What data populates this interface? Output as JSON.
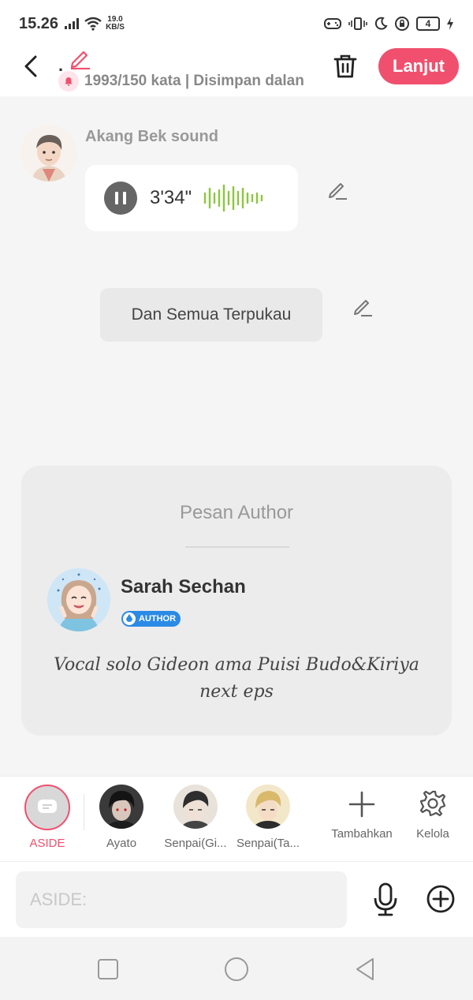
{
  "status": {
    "time": "15.26",
    "speed_top": "19.0",
    "speed_bottom": "KB/S",
    "battery": "4"
  },
  "header": {
    "title_marker": ".",
    "word_count": "1993/150 kata | Disimpan dalan",
    "next_label": "Lanjut"
  },
  "story": {
    "speaker_name": "Akang Bek sound",
    "audio_duration": "3'34\"",
    "text_bubble": "Dan Semua Terpukau"
  },
  "author_card": {
    "heading": "Pesan Author",
    "name": "Sarah Sechan",
    "badge": "AUTHOR",
    "message": "Vocal solo Gideon ama Puisi Budo&Kiriya next eps"
  },
  "characters": [
    {
      "label": "ASIDE"
    },
    {
      "label": "Ayato"
    },
    {
      "label": "Senpai(Gi..."
    },
    {
      "label": "Senpai(Ta..."
    }
  ],
  "tools": {
    "add_label": "Tambahkan",
    "manage_label": "Kelola"
  },
  "input": {
    "placeholder": "ASIDE:"
  },
  "colors": {
    "accent": "#f0506e",
    "waveform": "#8cc63f",
    "badge": "#2a8ae6"
  }
}
